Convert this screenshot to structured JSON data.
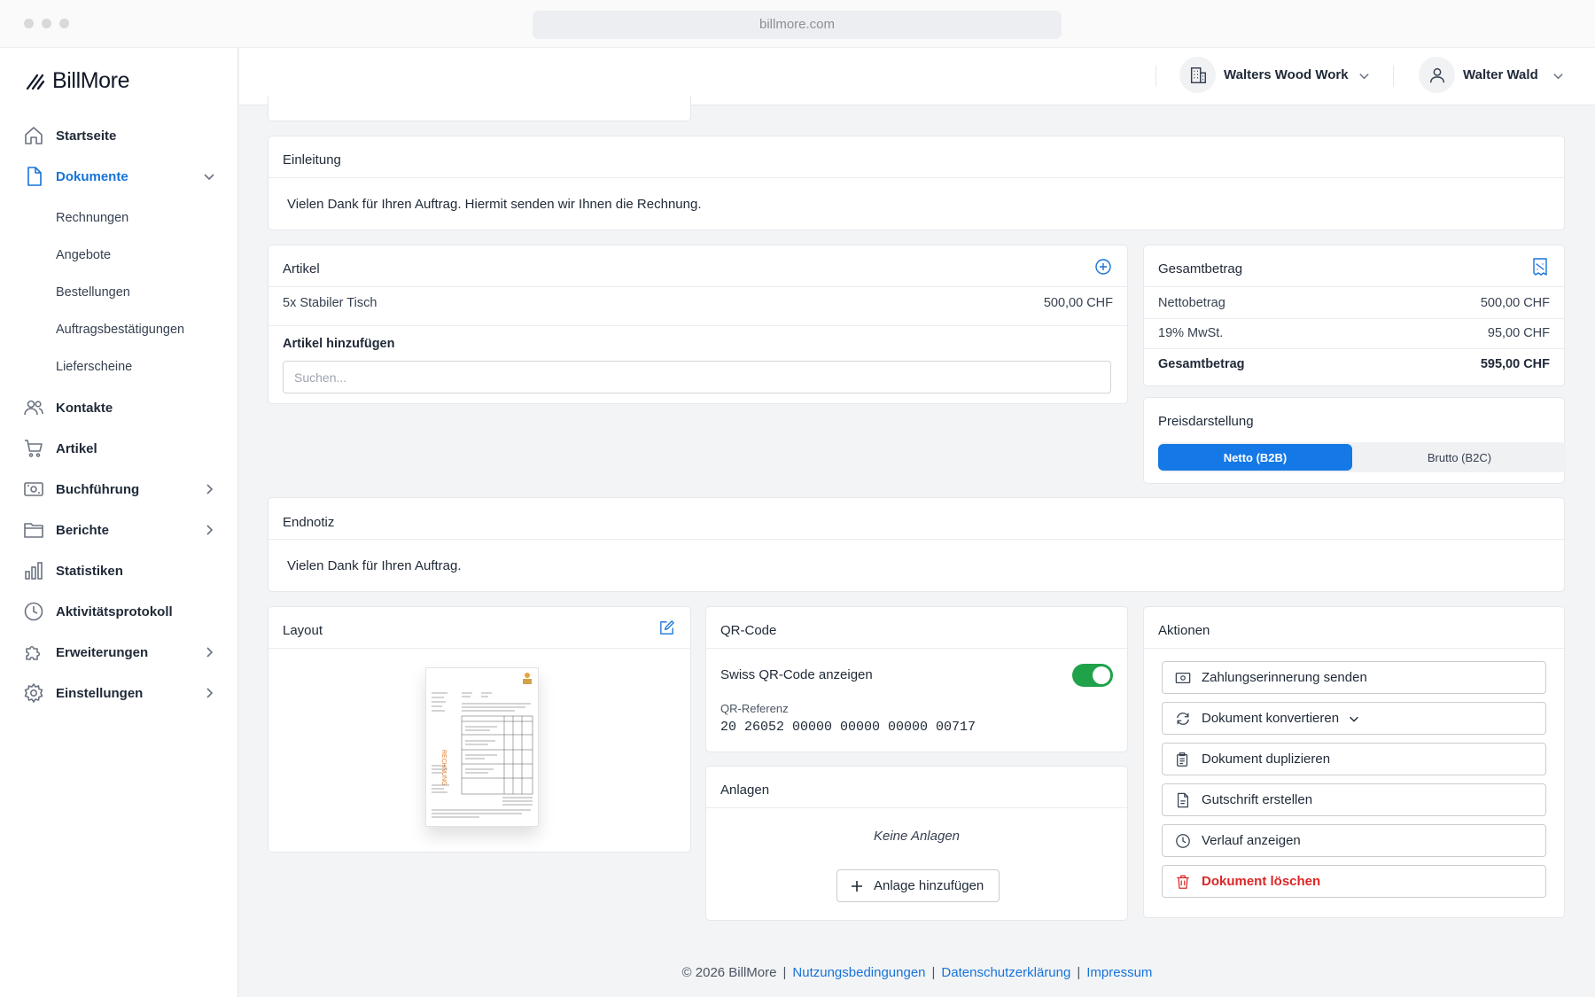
{
  "browser": {
    "url": "billmore.com"
  },
  "app": {
    "name": "BillMore"
  },
  "sidebar": {
    "items": [
      {
        "label": "Startseite",
        "icon": "home-icon"
      },
      {
        "label": "Dokumente",
        "icon": "document-icon",
        "active": true,
        "expanded": true
      },
      {
        "label": "Kontakte",
        "icon": "users-icon"
      },
      {
        "label": "Artikel",
        "icon": "cart-icon"
      },
      {
        "label": "Buchführung",
        "icon": "banknote-icon"
      },
      {
        "label": "Berichte",
        "icon": "folder-icon"
      },
      {
        "label": "Statistiken",
        "icon": "bar-chart-icon"
      },
      {
        "label": "Aktivitätsprotokoll",
        "icon": "clock-icon"
      },
      {
        "label": "Erweiterungen",
        "icon": "puzzle-icon"
      },
      {
        "label": "Einstellungen",
        "icon": "gear-icon"
      }
    ],
    "sub_items": [
      "Rechnungen",
      "Angebote",
      "Bestellungen",
      "Auftragsbestätigungen",
      "Lieferscheine"
    ]
  },
  "header": {
    "company": "Walters Wood Work",
    "user": "Walter Wald"
  },
  "einleitung": {
    "title": "Einleitung",
    "text": "Vielen Dank für Ihren Auftrag. Hiermit senden wir Ihnen die Rechnung."
  },
  "artikel": {
    "title": "Artikel",
    "items": [
      {
        "label": "5x Stabiler Tisch",
        "amount": "500,00 CHF"
      }
    ],
    "add_label": "Artikel hinzufügen",
    "search_placeholder": "Suchen..."
  },
  "gesamtbetrag": {
    "title": "Gesamtbetrag",
    "rows": [
      {
        "label": "Nettobetrag",
        "value": "500,00 CHF"
      },
      {
        "label": "19% MwSt.",
        "value": "95,00 CHF"
      },
      {
        "label": "Gesamtbetrag",
        "value": "595,00 CHF"
      }
    ]
  },
  "preisdarstellung": {
    "title": "Preisdarstellung",
    "options": [
      "Netto (B2B)",
      "Brutto (B2C)"
    ],
    "selected": "Netto (B2B)"
  },
  "endnotiz": {
    "title": "Endnotiz",
    "text": "Vielen Dank für Ihren Auftrag."
  },
  "layout": {
    "title": "Layout"
  },
  "qr": {
    "title": "QR-Code",
    "toggle_label": "Swiss QR-Code anzeigen",
    "toggle_on": true,
    "ref_label": "QR-Referenz",
    "ref_value": "20 26052 00000 00000 00000 00717"
  },
  "anlagen": {
    "title": "Anlagen",
    "empty": "Keine Anlagen",
    "add_label": "Anlage hinzufügen"
  },
  "aktionen": {
    "title": "Aktionen",
    "buttons": [
      "Zahlungserinnerung senden",
      "Dokument konvertieren",
      "Dokument duplizieren",
      "Gutschrift erstellen",
      "Verlauf anzeigen",
      "Dokument löschen"
    ]
  },
  "footer": {
    "copyright": "© 2026 BillMore",
    "links": [
      "Nutzungsbedingungen",
      "Datenschutzerklärung",
      "Impressum"
    ]
  },
  "colors": {
    "accent": "#1673d9",
    "toggle_on": "#1fa24a",
    "danger": "#dc2626"
  }
}
